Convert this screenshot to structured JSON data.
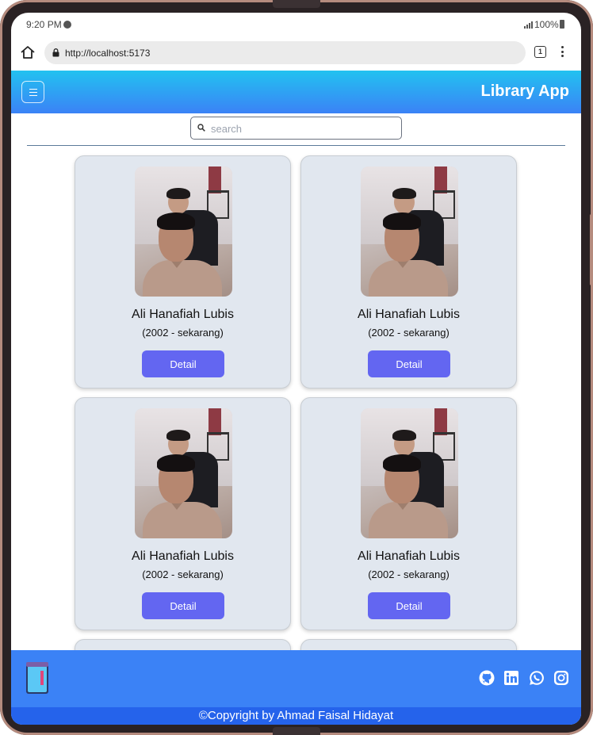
{
  "status_bar": {
    "time": "9:20 PM",
    "battery": "100%"
  },
  "browser": {
    "url": "http://localhost:5173",
    "tab_count": "1"
  },
  "header": {
    "title": "Library App"
  },
  "search": {
    "placeholder": "search"
  },
  "authors": [
    {
      "name": "Ali Hanafiah Lubis",
      "years": "(2002 - sekarang)",
      "button": "Detail"
    },
    {
      "name": "Ali Hanafiah Lubis",
      "years": "(2002 - sekarang)",
      "button": "Detail"
    },
    {
      "name": "Ali Hanafiah Lubis",
      "years": "(2002 - sekarang)",
      "button": "Detail"
    },
    {
      "name": "Ali Hanafiah Lubis",
      "years": "(2002 - sekarang)",
      "button": "Detail"
    }
  ],
  "footer": {
    "copyright": "©Copyright by Ahmad Faisal Hidayat",
    "social_icons": [
      "github-icon",
      "linkedin-icon",
      "whatsapp-icon",
      "instagram-icon"
    ]
  },
  "colors": {
    "header_gradient_start": "#22c2f0",
    "header_gradient_end": "#3b82f6",
    "card_bg": "#e1e7ef",
    "button": "#6366f1",
    "footer": "#3b82f6",
    "copyright_bar": "#2563eb"
  }
}
